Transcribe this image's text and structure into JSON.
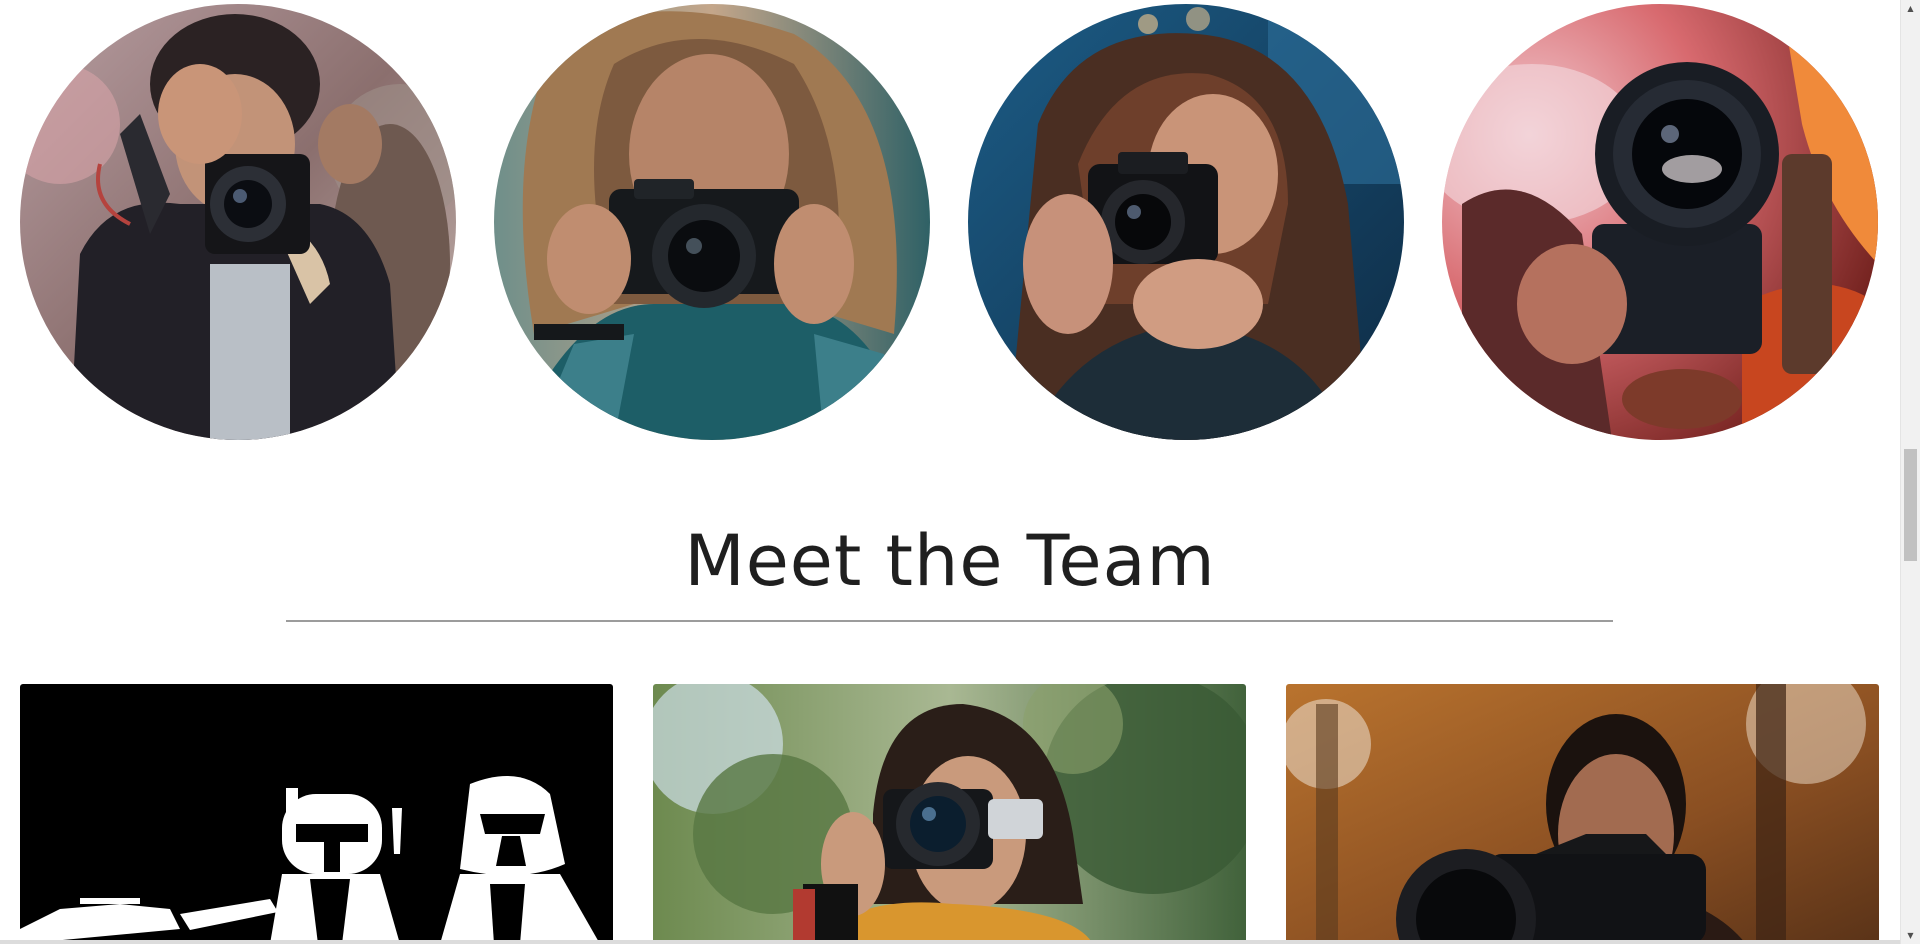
{
  "gallery": {
    "photos": [
      {
        "icon": "photographer-canon-photo"
      },
      {
        "icon": "photographer-mirrorless-photo"
      },
      {
        "icon": "photographer-canon-woman-photo"
      },
      {
        "icon": "camera-lens-smoke-photo"
      }
    ]
  },
  "team": {
    "heading": "Meet the Team",
    "members": [
      {
        "icon": "star-wars-characters-photo"
      },
      {
        "icon": "woman-camera-forest-photo"
      },
      {
        "icon": "man-nikon-camera-photo"
      }
    ]
  },
  "colors": {
    "heading_text": "#1f1f1f",
    "divider": "#9c9c9c",
    "page_background": "#ffffff",
    "scrollbar_track": "#f1f1f1",
    "scrollbar_thumb": "#c1c1c1"
  }
}
